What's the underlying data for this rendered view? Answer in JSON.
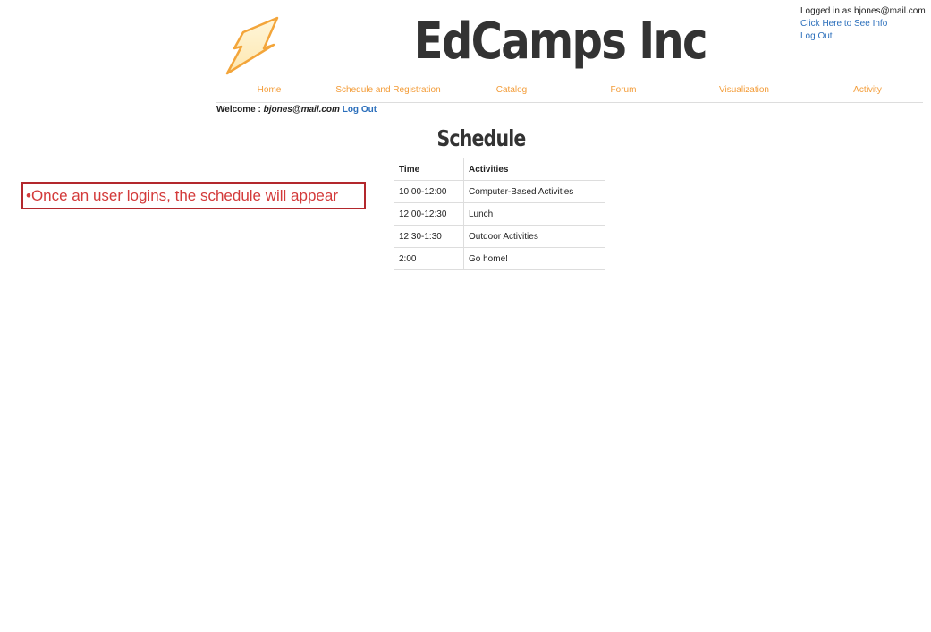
{
  "header": {
    "logo_icon": "lightning-bolt-icon",
    "site_title": "EdCamps Inc",
    "user_box": {
      "logged_in_text": "Logged in as bjones@mail.com",
      "info_link": "Click Here to See Info",
      "logout_link": "Log Out"
    }
  },
  "nav": {
    "items": [
      {
        "label": "Home"
      },
      {
        "label": "Schedule and Registration"
      },
      {
        "label": "Catalog"
      },
      {
        "label": "Forum"
      },
      {
        "label": "Visualization"
      },
      {
        "label": "Activity"
      }
    ],
    "color": "#f39c38"
  },
  "welcome": {
    "prefix": "Welcome : ",
    "email": "bjones@mail.com",
    "logout_link": "Log Out"
  },
  "main": {
    "title": "Schedule",
    "table": {
      "headers": [
        "Time",
        "Activities"
      ],
      "rows": [
        [
          "10:00-12:00",
          "Computer-Based Activities"
        ],
        [
          "12:00-12:30",
          "Lunch"
        ],
        [
          "12:30-1:30",
          "Outdoor Activities"
        ],
        [
          "2:00",
          "Go home!"
        ]
      ]
    }
  },
  "annotation": {
    "text": "•Once an user logins, the schedule will appear",
    "color": "#d33a3a"
  },
  "colors": {
    "link": "#2a6ebb",
    "accent_orange": "#f39c38",
    "annotation_border": "#b3282d"
  }
}
